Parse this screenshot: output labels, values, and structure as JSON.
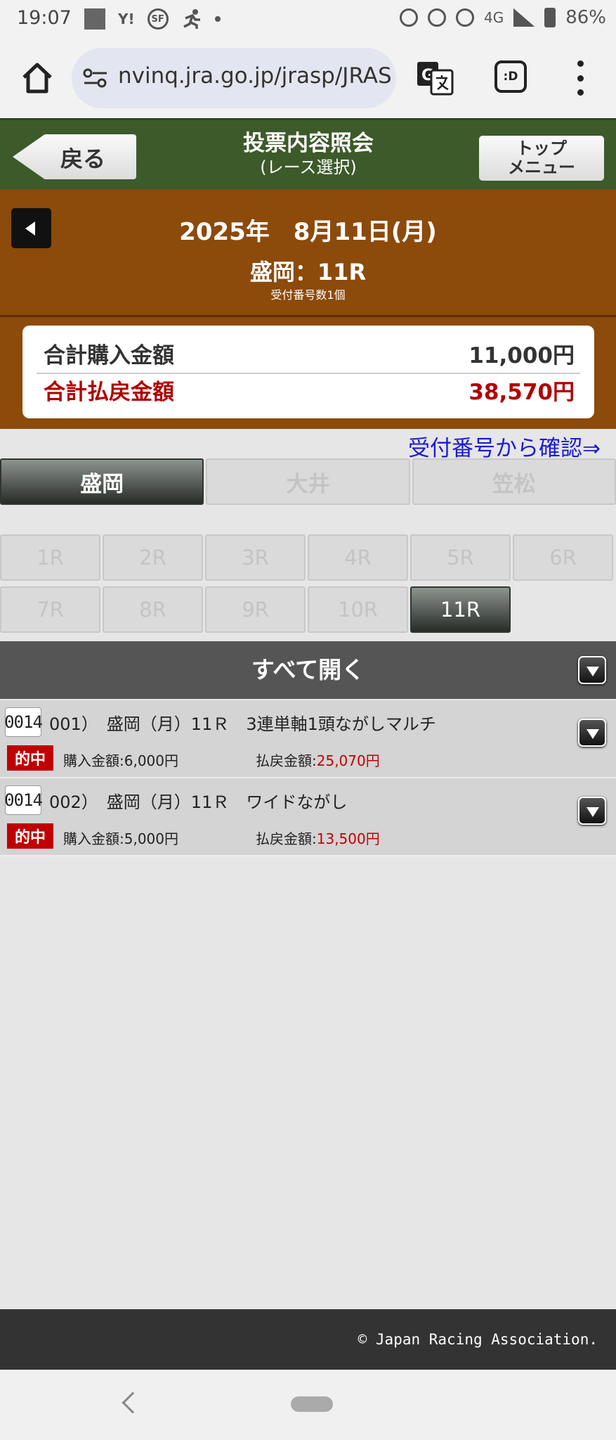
{
  "status_bar": {
    "time": "19:07",
    "yahoo": "Y!",
    "sf": "SF",
    "network": "4G",
    "battery": "86%"
  },
  "browser": {
    "url": "nvinq.jra.go.jp/jrasp/JRAS",
    "tab_icon": ":D"
  },
  "header": {
    "back_label": "戻る",
    "title": "投票内容照会",
    "subtitle": "(レース選択)",
    "top_menu_line1": "トップ",
    "top_menu_line2": "メニュー"
  },
  "race": {
    "date": "2025年　8月11日(月)",
    "venue": "盛岡：11R",
    "receipt_count": "受付番号数1個"
  },
  "totals": {
    "purchase_label": "合計購入金額",
    "purchase_amount": "11,000円",
    "payout_label": "合計払戻金額",
    "payout_amount": "38,570円"
  },
  "confirm_link": "受付番号から確認⇒",
  "venue_tabs": [
    "盛岡",
    "大井",
    "笠松"
  ],
  "race_buttons": [
    "1R",
    "2R",
    "3R",
    "4R",
    "5R",
    "6R",
    "7R",
    "8R",
    "9R",
    "10R",
    "11R"
  ],
  "open_all_label": "すべて開く",
  "entries": [
    {
      "number": "0014",
      "title": "001）　盛岡（月）11Ｒ　3連単軸1頭ながしマルチ",
      "badge": "的中",
      "buy_label": "購入金額:",
      "buy_amount": "6,000円",
      "pay_label": "払戻金額:",
      "pay_amount": "25,070円"
    },
    {
      "number": "0014",
      "title": "002）　盛岡（月）11Ｒ　ワイドながし",
      "badge": "的中",
      "buy_label": "購入金額:",
      "buy_amount": "5,000円",
      "pay_label": "払戻金額:",
      "pay_amount": "13,500円"
    }
  ],
  "footer": "© Japan Racing Association.",
  "colors": {
    "header_green": "#3d5a2a",
    "brown": "#8c4a0b",
    "red": "#c00000",
    "link_blue": "#1a1ad6"
  }
}
